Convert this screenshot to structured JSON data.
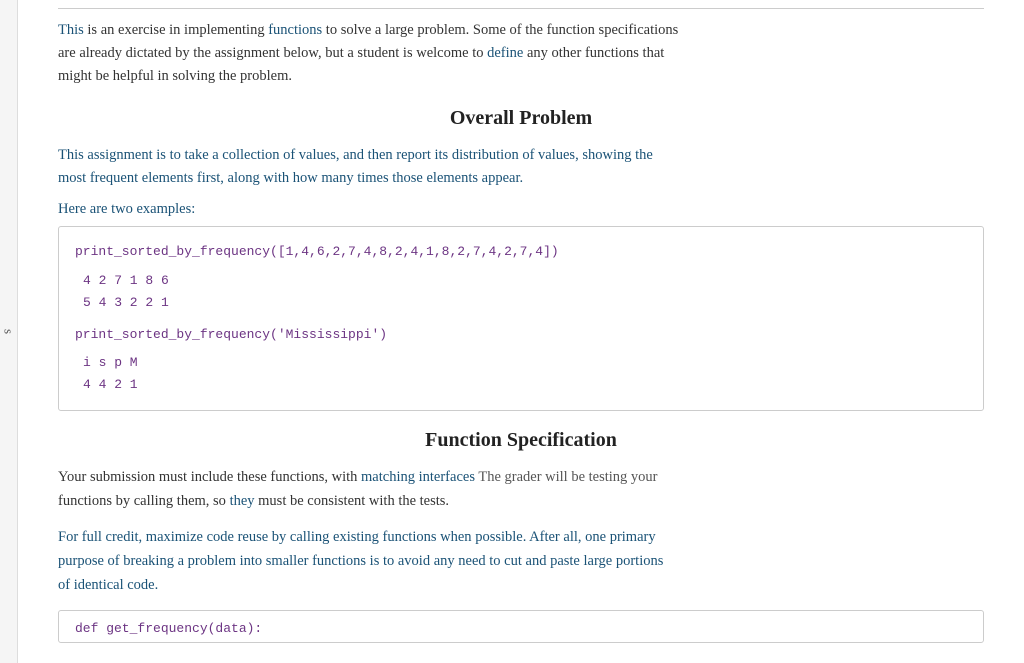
{
  "sidebar": {
    "letter": "s"
  },
  "intro": {
    "text1": "This",
    "text2": " is an exercise in implementing ",
    "text3": "functions",
    "text4": " to solve a large problem.   Some of the function specifications",
    "line2": "are already dictated by the assignment below, but a student is welcome to ",
    "define": "define",
    "line2b": " any other functions that",
    "line3": "might be helpful in solving the problem."
  },
  "overall_problem": {
    "title": "Overall Problem",
    "para1_part1": "This",
    "para1_part2": " assignment is to take a collection of values, and then report its ",
    "distribution": "distribution",
    "para1_part3": " of values, showing the",
    "para1_line2": "most frequent elements first, along with how many times those elements appear.",
    "examples_label": "Here are two examples:"
  },
  "code_example1": {
    "func_call": "print_sorted_by_frequency([1,4,6,2,7,4,8,2,4,1,8,2,7,4,2,7,4])",
    "output_row1": "4  2  7  1  8  6",
    "output_row2": "5  4  3  2  2  1"
  },
  "code_example2": {
    "func_call": "print_sorted_by_frequency('Mississippi')",
    "output_row1": "i  s  p  M",
    "output_row2": "4  4  2  1"
  },
  "function_spec": {
    "title": "Function Specification",
    "para1_intro": "Your submission must include these functions, with ",
    "matching": "matching interfaces",
    "para1_grader": "   The grader will be testing your",
    "para1_line2_part1": "functions by calling them, so ",
    "they": "they",
    "para1_line2_part2": " must be consistent with the tests.",
    "credit_line1_part1": "For full credit, maximize code reuse by calling existing functions ",
    "when": "when",
    "credit_line1_part2": " possible.   After all, one primary",
    "credit_line2": "purpose of breaking a problem into smaller functions is to avoid any need to cut and paste large portions",
    "credit_line3": "of identical code."
  },
  "bottom_code": {
    "func_def": "def get_frequency(data):"
  }
}
